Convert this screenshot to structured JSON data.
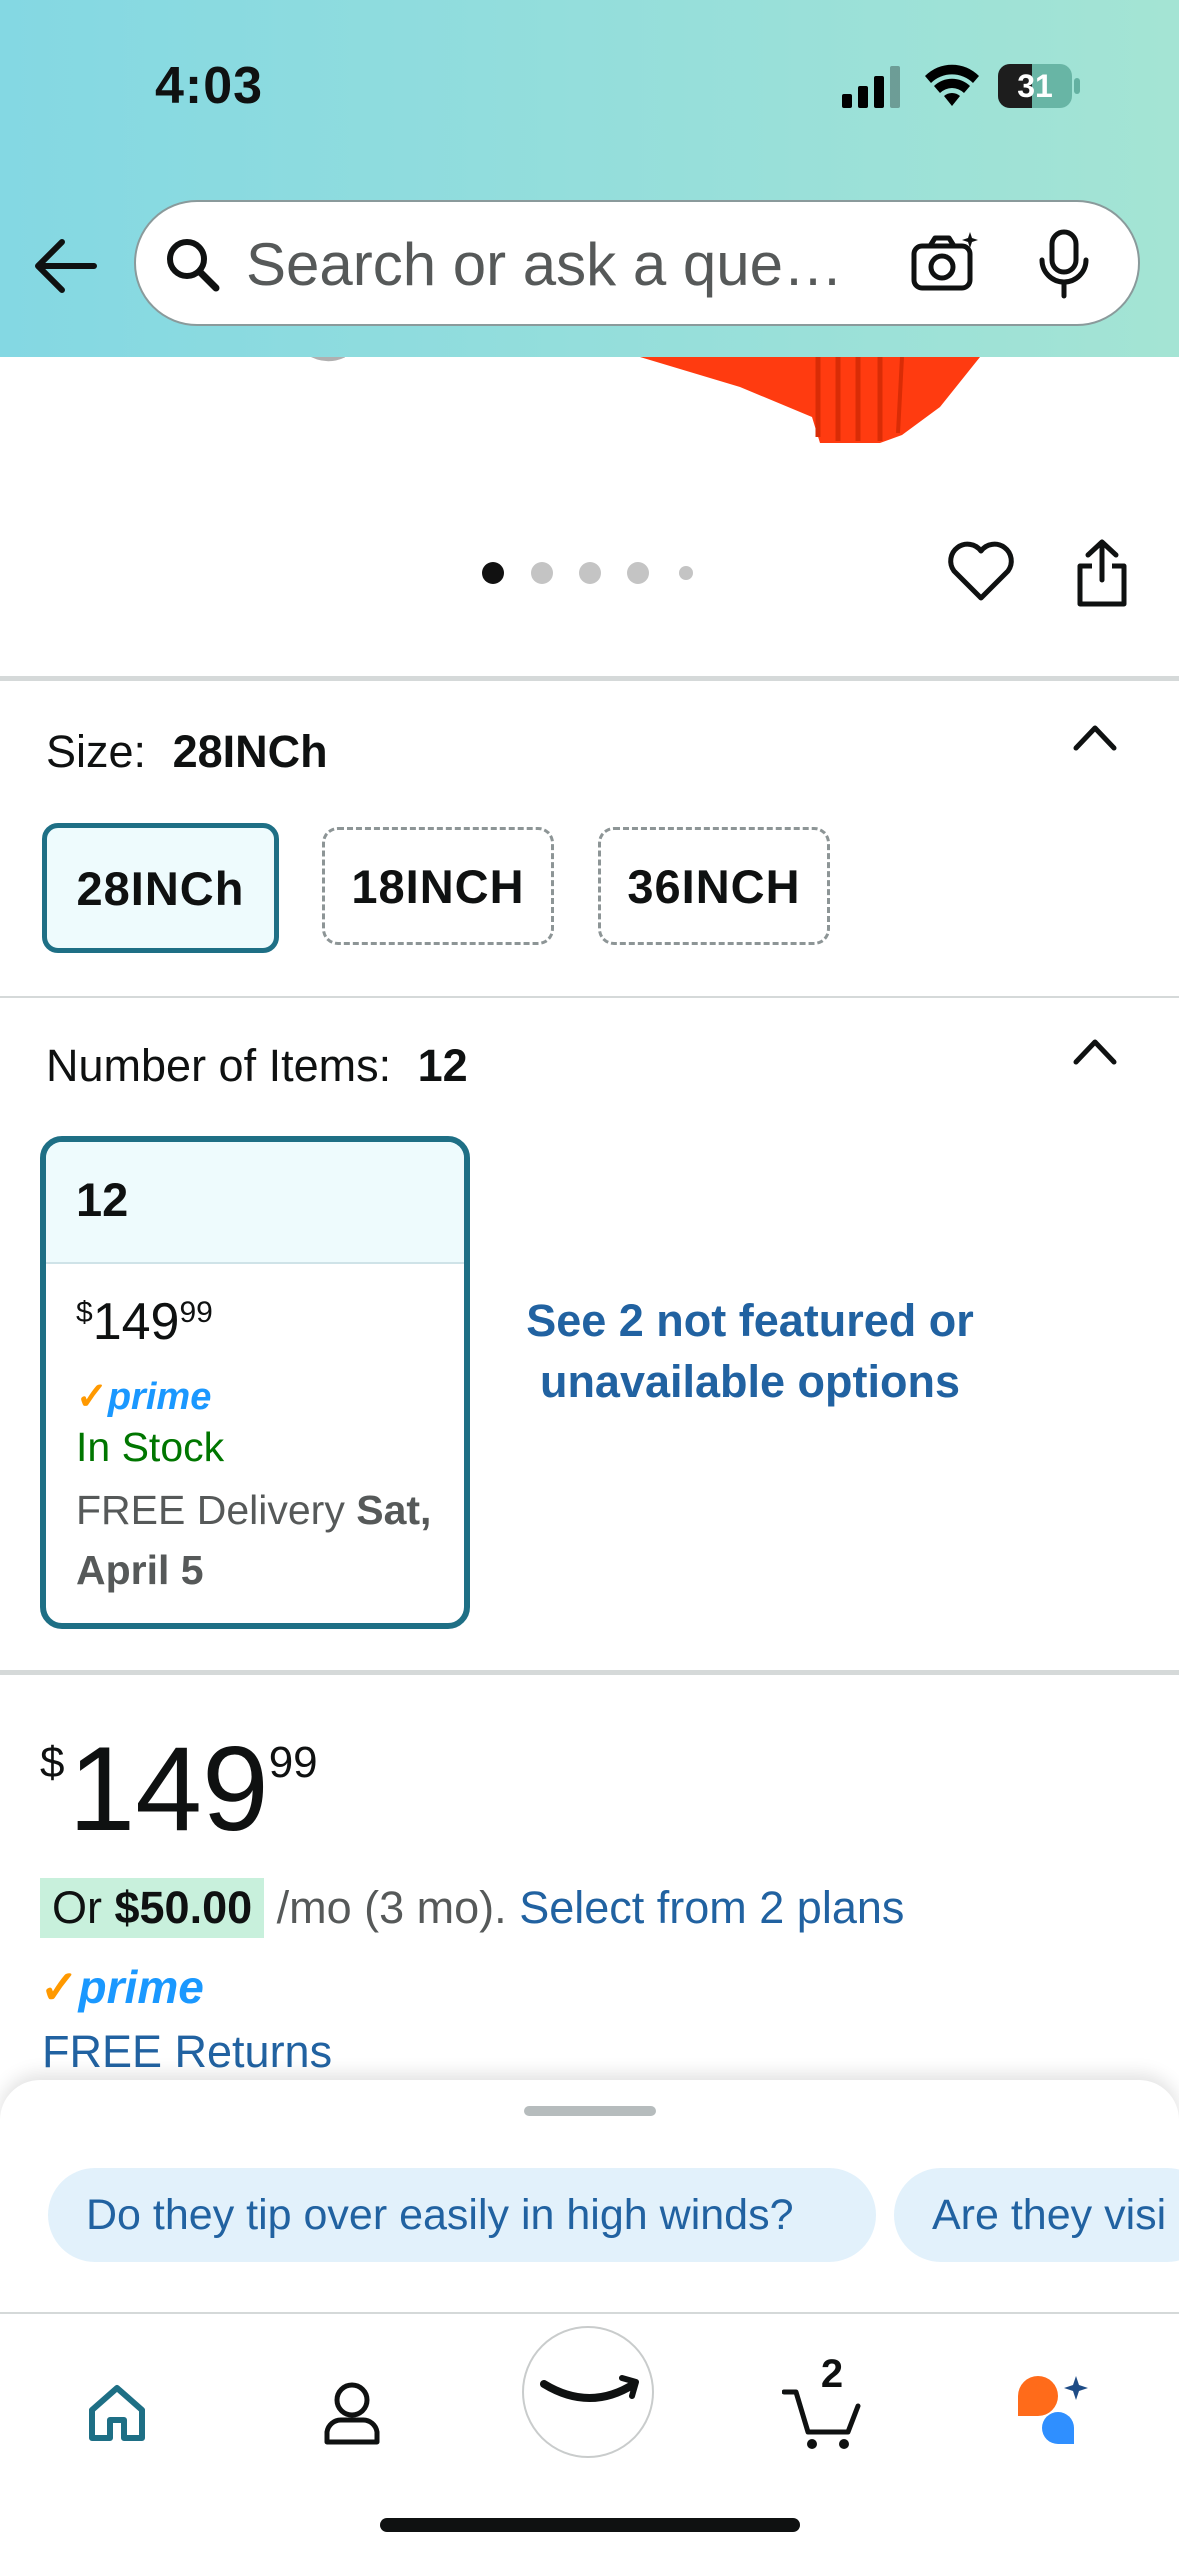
{
  "status_bar": {
    "time": "4:03",
    "battery": "31"
  },
  "search": {
    "placeholder": "Search or ask a que…"
  },
  "gallery": {
    "dot_count": 5,
    "active_index": 0
  },
  "size": {
    "label": "Size:",
    "selected": "28INCh",
    "options": [
      "28INCh",
      "18INCH",
      "36INCH"
    ]
  },
  "items": {
    "label": "Number of Items:",
    "selected": "12",
    "card": {
      "count": "12",
      "price_symbol": "$",
      "price_whole": "149",
      "price_cents": "99",
      "prime": "prime",
      "stock": "In Stock",
      "delivery_prefix": "FREE Delivery ",
      "delivery_date": "Sat, April 5"
    },
    "not_featured": "See 2 not featured or unavailable options"
  },
  "price": {
    "symbol": "$",
    "whole": "149",
    "cents": "99",
    "plan_or": "Or ",
    "plan_amount": "$50.00",
    "plan_term": " /mo (3 mo). ",
    "plan_link": "Select from 2 plans",
    "prime": "prime",
    "returns": "FREE Returns"
  },
  "suggestions": [
    "Do they tip over easily in high winds?",
    "Are they visi"
  ],
  "tabbar": {
    "cart_count": "2"
  },
  "colors": {
    "accent": "#1e6f85",
    "link": "#2162a1",
    "in_stock": "#007600",
    "prime_blue": "#1a98ff",
    "prime_check": "#ff9900"
  }
}
